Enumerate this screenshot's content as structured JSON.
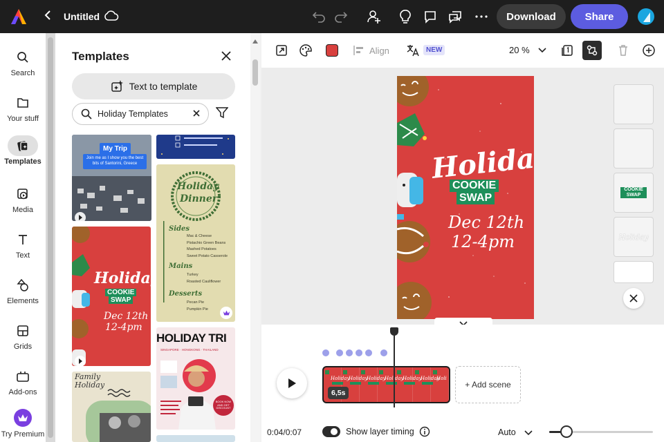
{
  "topbar": {
    "title": "Untitled",
    "download_label": "Download",
    "share_label": "Share"
  },
  "rail": {
    "items": [
      {
        "label": "Search",
        "icon": "search-icon"
      },
      {
        "label": "Your stuff",
        "icon": "folder-icon"
      },
      {
        "label": "Templates",
        "icon": "templates-icon"
      },
      {
        "label": "Media",
        "icon": "media-icon"
      },
      {
        "label": "Text",
        "icon": "text-icon"
      },
      {
        "label": "Elements",
        "icon": "elements-icon"
      },
      {
        "label": "Grids",
        "icon": "grids-icon"
      },
      {
        "label": "Add-ons",
        "icon": "add-ons-icon"
      },
      {
        "label": "Try Premium",
        "icon": "crown-icon"
      }
    ]
  },
  "panel": {
    "title": "Templates",
    "text_to_template_label": "Text to template",
    "search_value": "Holiday Templates",
    "templates": {
      "trip": {
        "title": "My Trip",
        "subtitle": "Join me as I show you the best bits of Santorini, Greece"
      },
      "dinner": {
        "title_line1": "Holiday",
        "title_line2": "Dinner",
        "sides_heading": "Sides",
        "sides": [
          "Mac & Cheese",
          "Pistachio Green Beans",
          "Mashed Potatoes",
          "Sweet Potato Casserole"
        ],
        "mains_heading": "Mains",
        "mains": [
          "Turkey",
          "Roasted Cauliflower"
        ],
        "desserts_heading": "Desserts",
        "desserts": [
          "Pecan Pie",
          "Pumpkin Pie"
        ]
      },
      "cookie": {
        "holiday": "Holiday",
        "cookie": "COOKIE",
        "swap": "SWAP",
        "date": "Dec 12th",
        "time": "12-4pm"
      },
      "family": {
        "line1": "Family",
        "line2": "Holiday"
      },
      "trip2": {
        "title": "HOLIDAY TRI",
        "countries": "SINGAPORE · HONGKONG · THAILAND",
        "cta": "BOOK NOW AND GET DISCOUNT"
      }
    }
  },
  "toolbar": {
    "align_label": "Align",
    "new_badge": "NEW",
    "zoom": "20 %",
    "fill_color": "#d8403e"
  },
  "canvas": {
    "holiday": "Holiday",
    "cookie": "COOKIE",
    "swap": "SWAP",
    "date": "Dec 12th",
    "time": "12-4pm",
    "thumb_cookie": "COOKIE SWAP",
    "thumb_holiday": "Holiday"
  },
  "timeline": {
    "duration_badge": "6,5s",
    "add_scene_label": "+ Add scene",
    "time_readout": "0:04/0:07",
    "layer_timing_label": "Show layer timing",
    "layer_timing_on": true,
    "auto_label": "Auto",
    "zoom_fraction": 0.15
  },
  "colors": {
    "accent": "#5c5ce0",
    "card_red": "#d8403e",
    "cookie_green": "#1e8f5a"
  }
}
